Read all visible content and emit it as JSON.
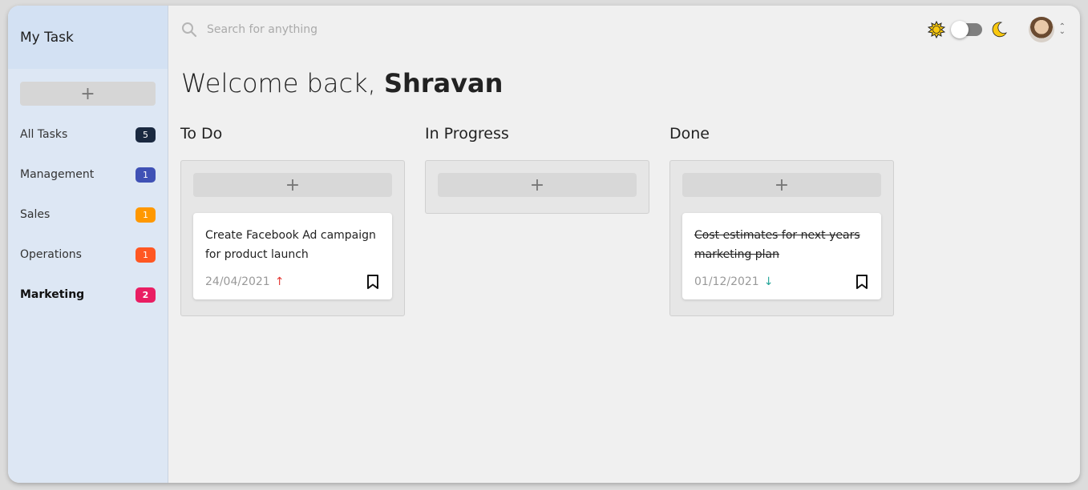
{
  "sidebar": {
    "title": "My Task",
    "add_label": "+",
    "items": [
      {
        "label": "All Tasks",
        "count": "5",
        "color": "#1a2940"
      },
      {
        "label": "Management",
        "count": "1",
        "color": "#3f51b5"
      },
      {
        "label": "Sales",
        "count": "1",
        "color": "#ff9800"
      },
      {
        "label": "Operations",
        "count": "1",
        "color": "#ff5722"
      },
      {
        "label": "Marketing",
        "count": "2",
        "color": "#e91e63"
      }
    ]
  },
  "header": {
    "search_placeholder": "Search for anything"
  },
  "welcome": {
    "prefix": "Welcome back, ",
    "name": "Shravan"
  },
  "columns": [
    {
      "title": "To Do",
      "add_label": "+",
      "card": {
        "title": "Create Facebook Ad campaign for product launch",
        "date": "24/04/2021",
        "arrow": "↑",
        "arrow_color": "#e53935"
      }
    },
    {
      "title": "In Progress",
      "add_label": "+"
    },
    {
      "title": "Done",
      "add_label": "+",
      "card": {
        "title": "Cost estimates for next years marketing plan",
        "date": "01/12/2021",
        "arrow": "↓",
        "arrow_color": "#26a69a"
      }
    }
  ]
}
